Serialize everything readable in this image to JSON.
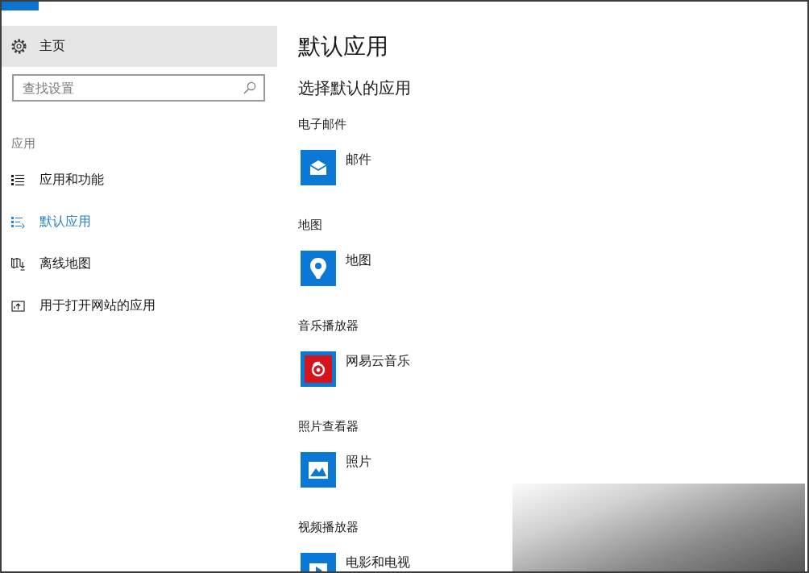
{
  "sidebar": {
    "home": {
      "label": "主页"
    },
    "search": {
      "placeholder": "查找设置"
    },
    "section": "应用",
    "items": [
      {
        "label": "应用和功能",
        "kind": "features",
        "selected": false
      },
      {
        "label": "默认应用",
        "kind": "defaults",
        "selected": true
      },
      {
        "label": "离线地图",
        "kind": "maps",
        "selected": false
      },
      {
        "label": "用于打开网站的应用",
        "kind": "websites",
        "selected": false
      }
    ]
  },
  "content": {
    "title": "默认应用",
    "subtitle": "选择默认的应用",
    "categories": [
      {
        "label": "电子邮件",
        "app": {
          "name": "邮件",
          "kind": "mail"
        }
      },
      {
        "label": "地图",
        "app": {
          "name": "地图",
          "kind": "maps"
        }
      },
      {
        "label": "音乐播放器",
        "app": {
          "name": "网易云音乐",
          "kind": "music"
        }
      },
      {
        "label": "照片查看器",
        "app": {
          "name": "照片",
          "kind": "photos"
        }
      },
      {
        "label": "视频播放器",
        "app": {
          "name": "电影和电视",
          "kind": "video"
        }
      }
    ]
  }
}
